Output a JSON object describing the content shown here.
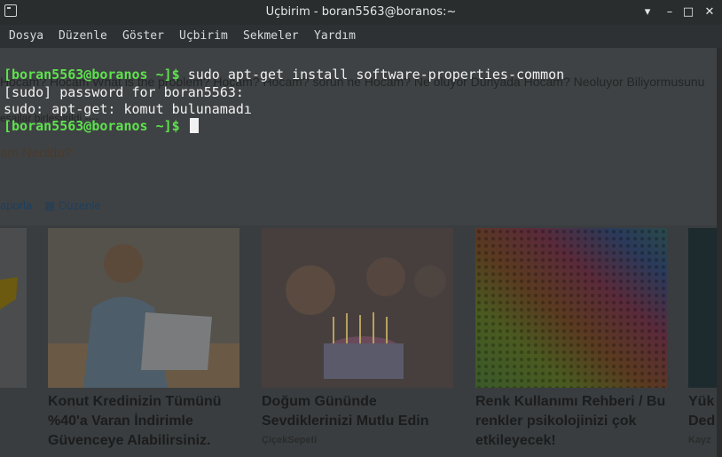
{
  "window": {
    "title": "Uçbirim - boran5563@boranos:~",
    "minimize_glyph": "▾",
    "iconify_glyph": "–",
    "maximize_glyph": "□",
    "close_glyph": "✕"
  },
  "menu": [
    "Dosya",
    "Düzenle",
    "Göster",
    "Uçbirim",
    "Sekmeler",
    "Yardım"
  ],
  "terminal": {
    "prompt": "[boran5563@boranos ~]$",
    "lines": [
      {
        "prompt": "[boran5563@boranos ~]$",
        "text": " sudo apt-get install software-properties-common"
      },
      {
        "prompt": "",
        "text": "[sudo] password for boran5563:"
      },
      {
        "prompt": "",
        "text": "sudo: apt-get: komut bulunamadı"
      },
      {
        "prompt": "[boran5563@boranos ~]$",
        "text": " "
      }
    ]
  },
  "background_page": {
    "line1": "Hocam? Hocam What is the problem? Hocam? Hocam? sorun ne Hocam? Ne oluyor Dünyada Hocam? Neoluyor Biliyormusunu",
    "line2": "esajlar birleştirildi ----",
    "heading": "am Neoldu?",
    "report": "aporla",
    "edit": "Düzenle",
    "cards": [
      {
        "title": "Konut Kredinizin Tümünü %40'a Varan İndirimle Güvenceye Alabilirsiniz.",
        "source": ""
      },
      {
        "title": "Doğum Gününde Sevdiklerinizi Mutlu Edin",
        "source": "ÇiçekSepeti"
      },
      {
        "title": "Renk Kullanımı Rehberi / Bu renkler psikolojinizi çok etkileyecek!",
        "source": ""
      },
      {
        "title": "Yük Ded",
        "source": "Kayz"
      }
    ]
  },
  "colors": {
    "prompt": "#5ee24e",
    "text": "#f2f2f2",
    "titlebar": "#2a2d2e"
  }
}
